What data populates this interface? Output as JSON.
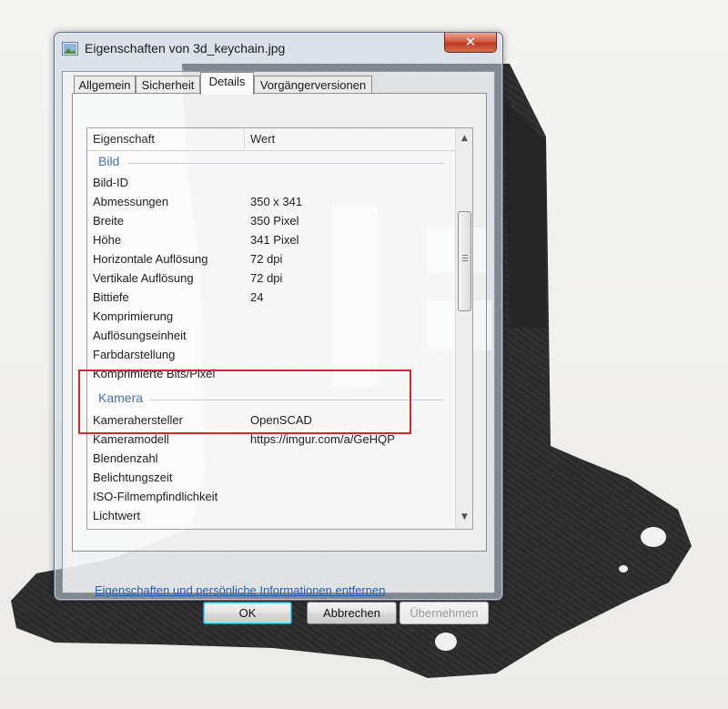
{
  "window": {
    "title": "Eigenschaften von 3d_keychain.jpg",
    "close_symbol": "✕"
  },
  "tabs": [
    {
      "label": "Allgemein",
      "active": false
    },
    {
      "label": "Sicherheit",
      "active": false
    },
    {
      "label": "Details",
      "active": true
    },
    {
      "label": "Vorgängerversionen",
      "active": false
    }
  ],
  "table": {
    "col_property": "Eigenschaft",
    "col_value": "Wert",
    "groups": [
      {
        "label": "Bild",
        "rows": [
          {
            "key": "Bild-ID",
            "value": ""
          },
          {
            "key": "Abmessungen",
            "value": "350 x 341"
          },
          {
            "key": "Breite",
            "value": "350 Pixel"
          },
          {
            "key": "Höhe",
            "value": "341 Pixel"
          },
          {
            "key": "Horizontale Auflösung",
            "value": "72 dpi"
          },
          {
            "key": "Vertikale Auflösung",
            "value": "72 dpi"
          },
          {
            "key": "Bittiefe",
            "value": "24"
          },
          {
            "key": "Komprimierung",
            "value": ""
          },
          {
            "key": "Auflösungseinheit",
            "value": ""
          },
          {
            "key": "Farbdarstellung",
            "value": ""
          },
          {
            "key": "Komprimierte Bits/Pixel",
            "value": ""
          }
        ]
      },
      {
        "label": "Kamera",
        "rows": [
          {
            "key": "Kamerahersteller",
            "value": "OpenSCAD"
          },
          {
            "key": "Kameramodell",
            "value": "https://imgur.com/a/GeHQP"
          },
          {
            "key": "Blendenzahl",
            "value": ""
          },
          {
            "key": "Belichtungszeit",
            "value": ""
          },
          {
            "key": "ISO-Filmempfindlichkeit",
            "value": ""
          },
          {
            "key": "Lichtwert",
            "value": ""
          }
        ]
      }
    ]
  },
  "link": "Eigenschaften und persönliche Informationen entfernen",
  "buttons": {
    "ok": "OK",
    "cancel": "Abbrechen",
    "apply": "Übernehmen"
  },
  "colors": {
    "highlight": "#d8262a",
    "group_header": "#4e6ea8",
    "link": "#1a5fb8"
  }
}
